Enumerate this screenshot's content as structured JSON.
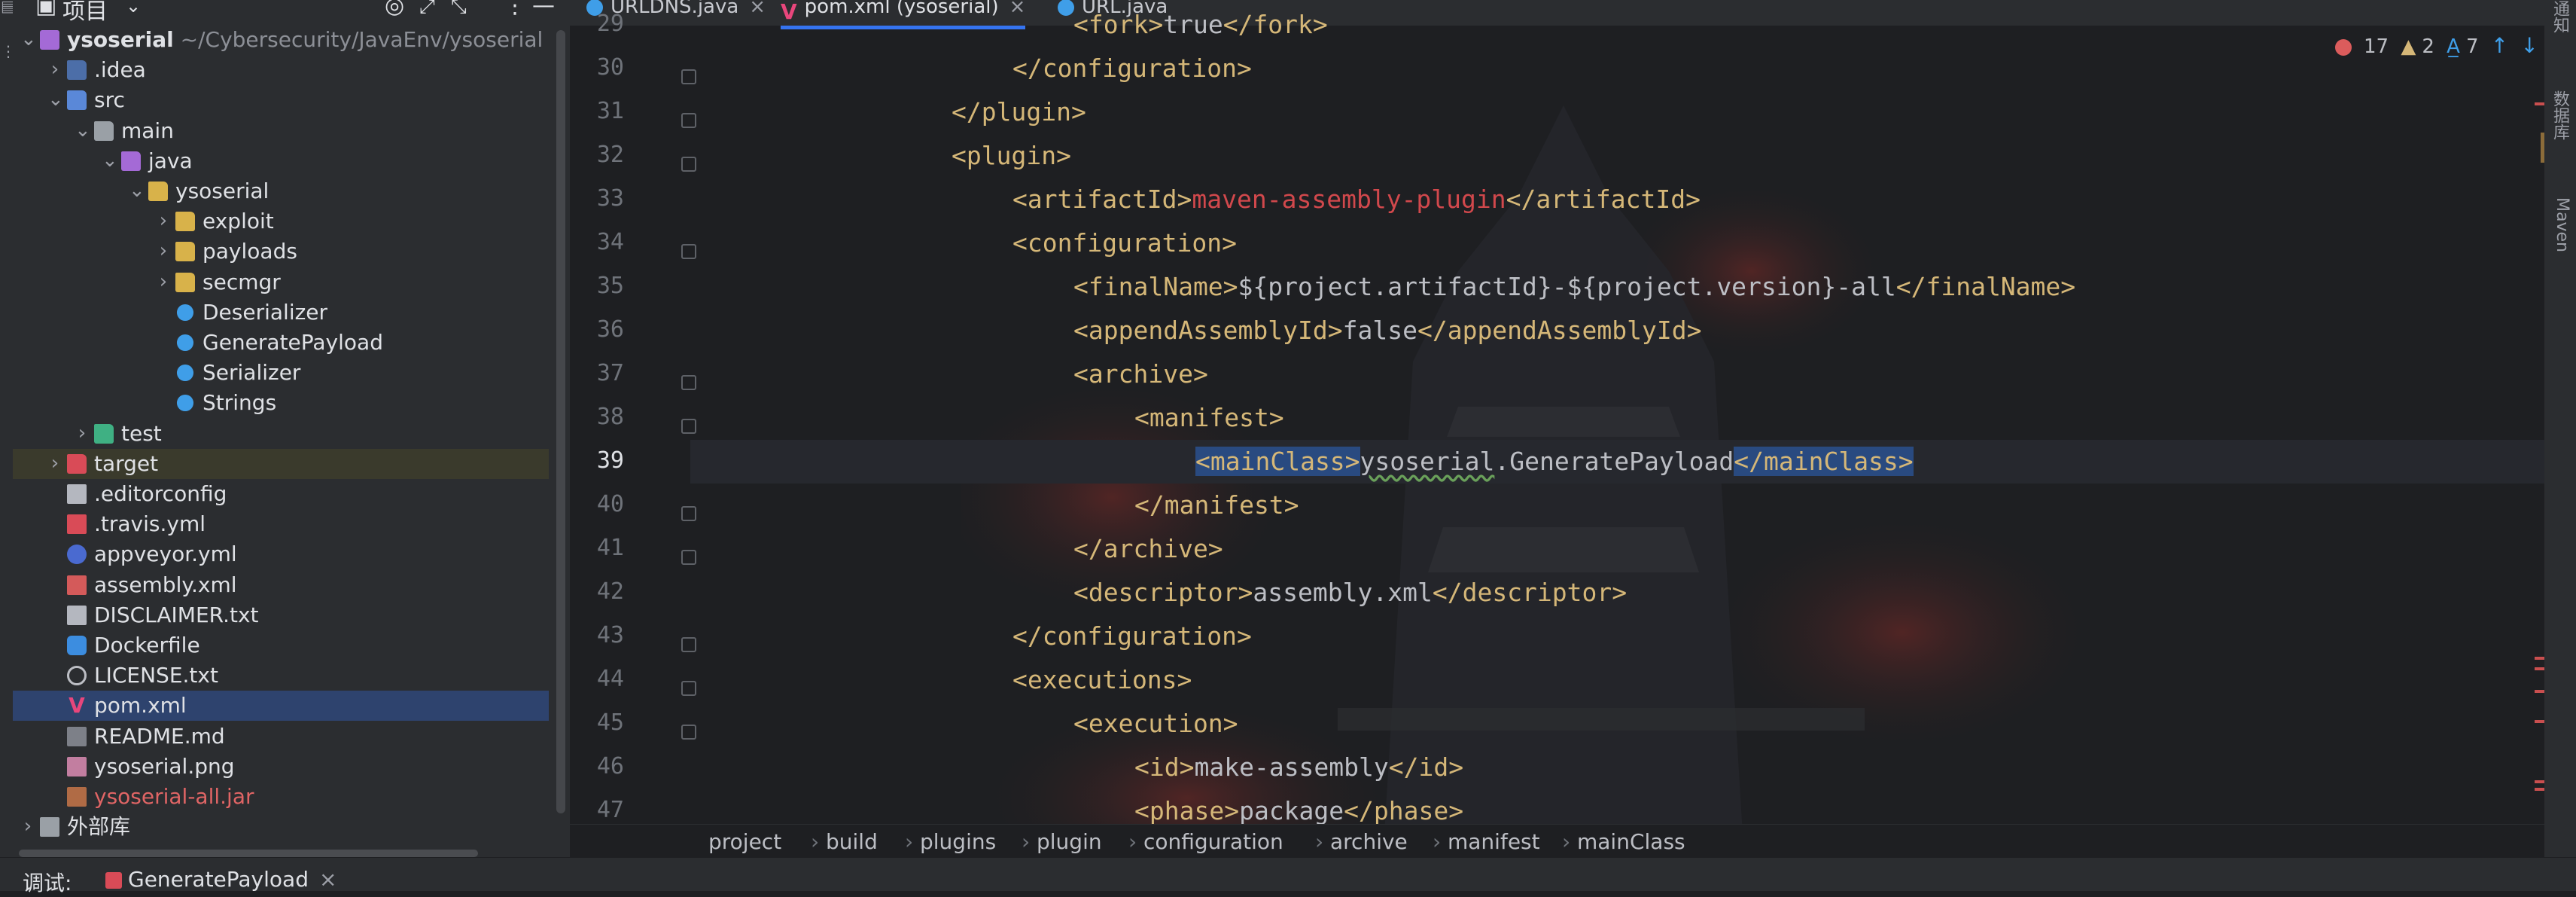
{
  "window": {
    "project_panel_title": "项目",
    "panel_icons": [
      "target-icon",
      "expand-icon",
      "collapse-icon",
      "more-icon",
      "minimize-icon"
    ]
  },
  "tree": [
    {
      "label": "ysoserial",
      "path": "~/Cybersecurity/JavaEnv/ysoserial",
      "icon": "module",
      "depth": 0,
      "expanded": true
    },
    {
      "label": ".idea",
      "icon": "folder-idea",
      "depth": 1,
      "expanded": false
    },
    {
      "label": "src",
      "icon": "folder-src",
      "depth": 1,
      "expanded": true
    },
    {
      "label": "main",
      "icon": "folder-plain",
      "depth": 2,
      "expanded": true
    },
    {
      "label": "java",
      "icon": "folder-java",
      "depth": 3,
      "expanded": true
    },
    {
      "label": "ysoserial",
      "icon": "folder",
      "depth": 4,
      "expanded": true
    },
    {
      "label": "exploit",
      "icon": "folder",
      "depth": 5,
      "expanded": false
    },
    {
      "label": "payloads",
      "icon": "folder",
      "depth": 5,
      "expanded": false
    },
    {
      "label": "secmgr",
      "icon": "folder",
      "depth": 5,
      "expanded": false
    },
    {
      "label": "Deserializer",
      "icon": "class",
      "depth": 5
    },
    {
      "label": "GeneratePayload",
      "icon": "class",
      "depth": 5
    },
    {
      "label": "Serializer",
      "icon": "class",
      "depth": 5
    },
    {
      "label": "Strings",
      "icon": "class",
      "depth": 5
    },
    {
      "label": "test",
      "icon": "folder-test",
      "depth": 2,
      "expanded": false
    },
    {
      "label": "target",
      "icon": "folder-target",
      "depth": 1,
      "expanded": false,
      "highlight": true
    },
    {
      "label": ".editorconfig",
      "icon": "file",
      "depth": 1
    },
    {
      "label": ".travis.yml",
      "icon": "yml",
      "depth": 1
    },
    {
      "label": "appveyor.yml",
      "icon": "appveyor",
      "depth": 1
    },
    {
      "label": "assembly.xml",
      "icon": "xml",
      "depth": 1
    },
    {
      "label": "DISCLAIMER.txt",
      "icon": "file",
      "depth": 1
    },
    {
      "label": "Dockerfile",
      "icon": "docker",
      "depth": 1
    },
    {
      "label": "LICENSE.txt",
      "icon": "license",
      "depth": 1
    },
    {
      "label": "pom.xml",
      "icon": "maven",
      "depth": 1,
      "selected": true
    },
    {
      "label": "README.md",
      "icon": "md",
      "depth": 1
    },
    {
      "label": "ysoserial.png",
      "icon": "png",
      "depth": 1
    },
    {
      "label": "ysoserial-all.jar",
      "icon": "jar",
      "depth": 1,
      "red": true
    },
    {
      "label": "外部库",
      "icon": "lib",
      "depth": 0,
      "expanded": false
    }
  ],
  "tabs": [
    {
      "label": "URLDNS.java",
      "icon": "class",
      "active": false
    },
    {
      "label": "pom.xml (ysoserial)",
      "icon": "maven",
      "active": true
    },
    {
      "label": "URL.java",
      "icon": "class",
      "active": false
    }
  ],
  "editor": {
    "first_line": 29,
    "current_line": 39,
    "lines": [
      {
        "n": 29,
        "indent": 3,
        "tokens": [
          [
            "t",
            "<fork>"
          ],
          [
            "tx",
            "true"
          ],
          [
            "t",
            "</fork>"
          ]
        ]
      },
      {
        "n": 30,
        "indent": 2,
        "tokens": [
          [
            "t",
            "</configuration>"
          ]
        ]
      },
      {
        "n": 31,
        "indent": 1,
        "tokens": [
          [
            "t",
            "</plugin>"
          ]
        ]
      },
      {
        "n": 32,
        "indent": 1,
        "tokens": [
          [
            "t",
            "<plugin>"
          ]
        ]
      },
      {
        "n": 33,
        "indent": 2,
        "tokens": [
          [
            "t",
            "<artifactId>"
          ],
          [
            "tr",
            "maven-assembly-plugin"
          ],
          [
            "t",
            "</artifactId>"
          ]
        ]
      },
      {
        "n": 34,
        "indent": 2,
        "tokens": [
          [
            "t",
            "<configuration>"
          ]
        ]
      },
      {
        "n": 35,
        "indent": 3,
        "tokens": [
          [
            "t",
            "<finalName>"
          ],
          [
            "tx",
            "${project.artifactId}-${project.version}-all"
          ],
          [
            "t",
            "</finalName>"
          ]
        ]
      },
      {
        "n": 36,
        "indent": 3,
        "tokens": [
          [
            "t",
            "<appendAssemblyId>"
          ],
          [
            "tx",
            "false"
          ],
          [
            "t",
            "</appendAssemblyId>"
          ]
        ]
      },
      {
        "n": 37,
        "indent": 3,
        "tokens": [
          [
            "t",
            "<archive>"
          ]
        ]
      },
      {
        "n": 38,
        "indent": 4,
        "tokens": [
          [
            "t",
            "<manifest>"
          ]
        ]
      },
      {
        "n": 39,
        "indent": 5,
        "tokens": [
          [
            "t-hl",
            "<mainClass>"
          ],
          [
            "sq",
            "ysoserial"
          ],
          [
            "tx",
            ".GeneratePayload"
          ],
          [
            "t-hl",
            "</mainClass>"
          ]
        ]
      },
      {
        "n": 40,
        "indent": 4,
        "tokens": [
          [
            "t",
            "</manifest>"
          ]
        ]
      },
      {
        "n": 41,
        "indent": 3,
        "tokens": [
          [
            "t",
            "</archive>"
          ]
        ]
      },
      {
        "n": 42,
        "indent": 3,
        "tokens": [
          [
            "t",
            "<descriptor>"
          ],
          [
            "tx",
            "assembly.xml"
          ],
          [
            "t",
            "</descriptor>"
          ]
        ]
      },
      {
        "n": 43,
        "indent": 2,
        "tokens": [
          [
            "t",
            "</configuration>"
          ]
        ]
      },
      {
        "n": 44,
        "indent": 2,
        "tokens": [
          [
            "t",
            "<executions>"
          ]
        ]
      },
      {
        "n": 45,
        "indent": 3,
        "tokens": [
          [
            "t",
            "<execution>"
          ]
        ]
      },
      {
        "n": 46,
        "indent": 4,
        "tokens": [
          [
            "t",
            "<id>"
          ],
          [
            "tx",
            "make-assembly"
          ],
          [
            "t",
            "</id>"
          ]
        ]
      },
      {
        "n": 47,
        "indent": 4,
        "tokens": [
          [
            "t",
            "<phase>"
          ],
          [
            "tx",
            "package"
          ],
          [
            "t",
            "</phase>"
          ]
        ]
      }
    ]
  },
  "inspections": {
    "errors": "17",
    "warnings": "2",
    "typos": "7"
  },
  "breadcrumb": [
    "project",
    "build",
    "plugins",
    "plugin",
    "configuration",
    "archive",
    "manifest",
    "mainClass"
  ],
  "right_tools": [
    "通知",
    "数据库",
    "Maven"
  ],
  "debug": {
    "label": "调试:",
    "tab": "GeneratePayload"
  },
  "colors": {
    "accent": "#3574f0",
    "tag": "#d5b778",
    "error": "#db5c5c",
    "background": "#1e1f22"
  }
}
